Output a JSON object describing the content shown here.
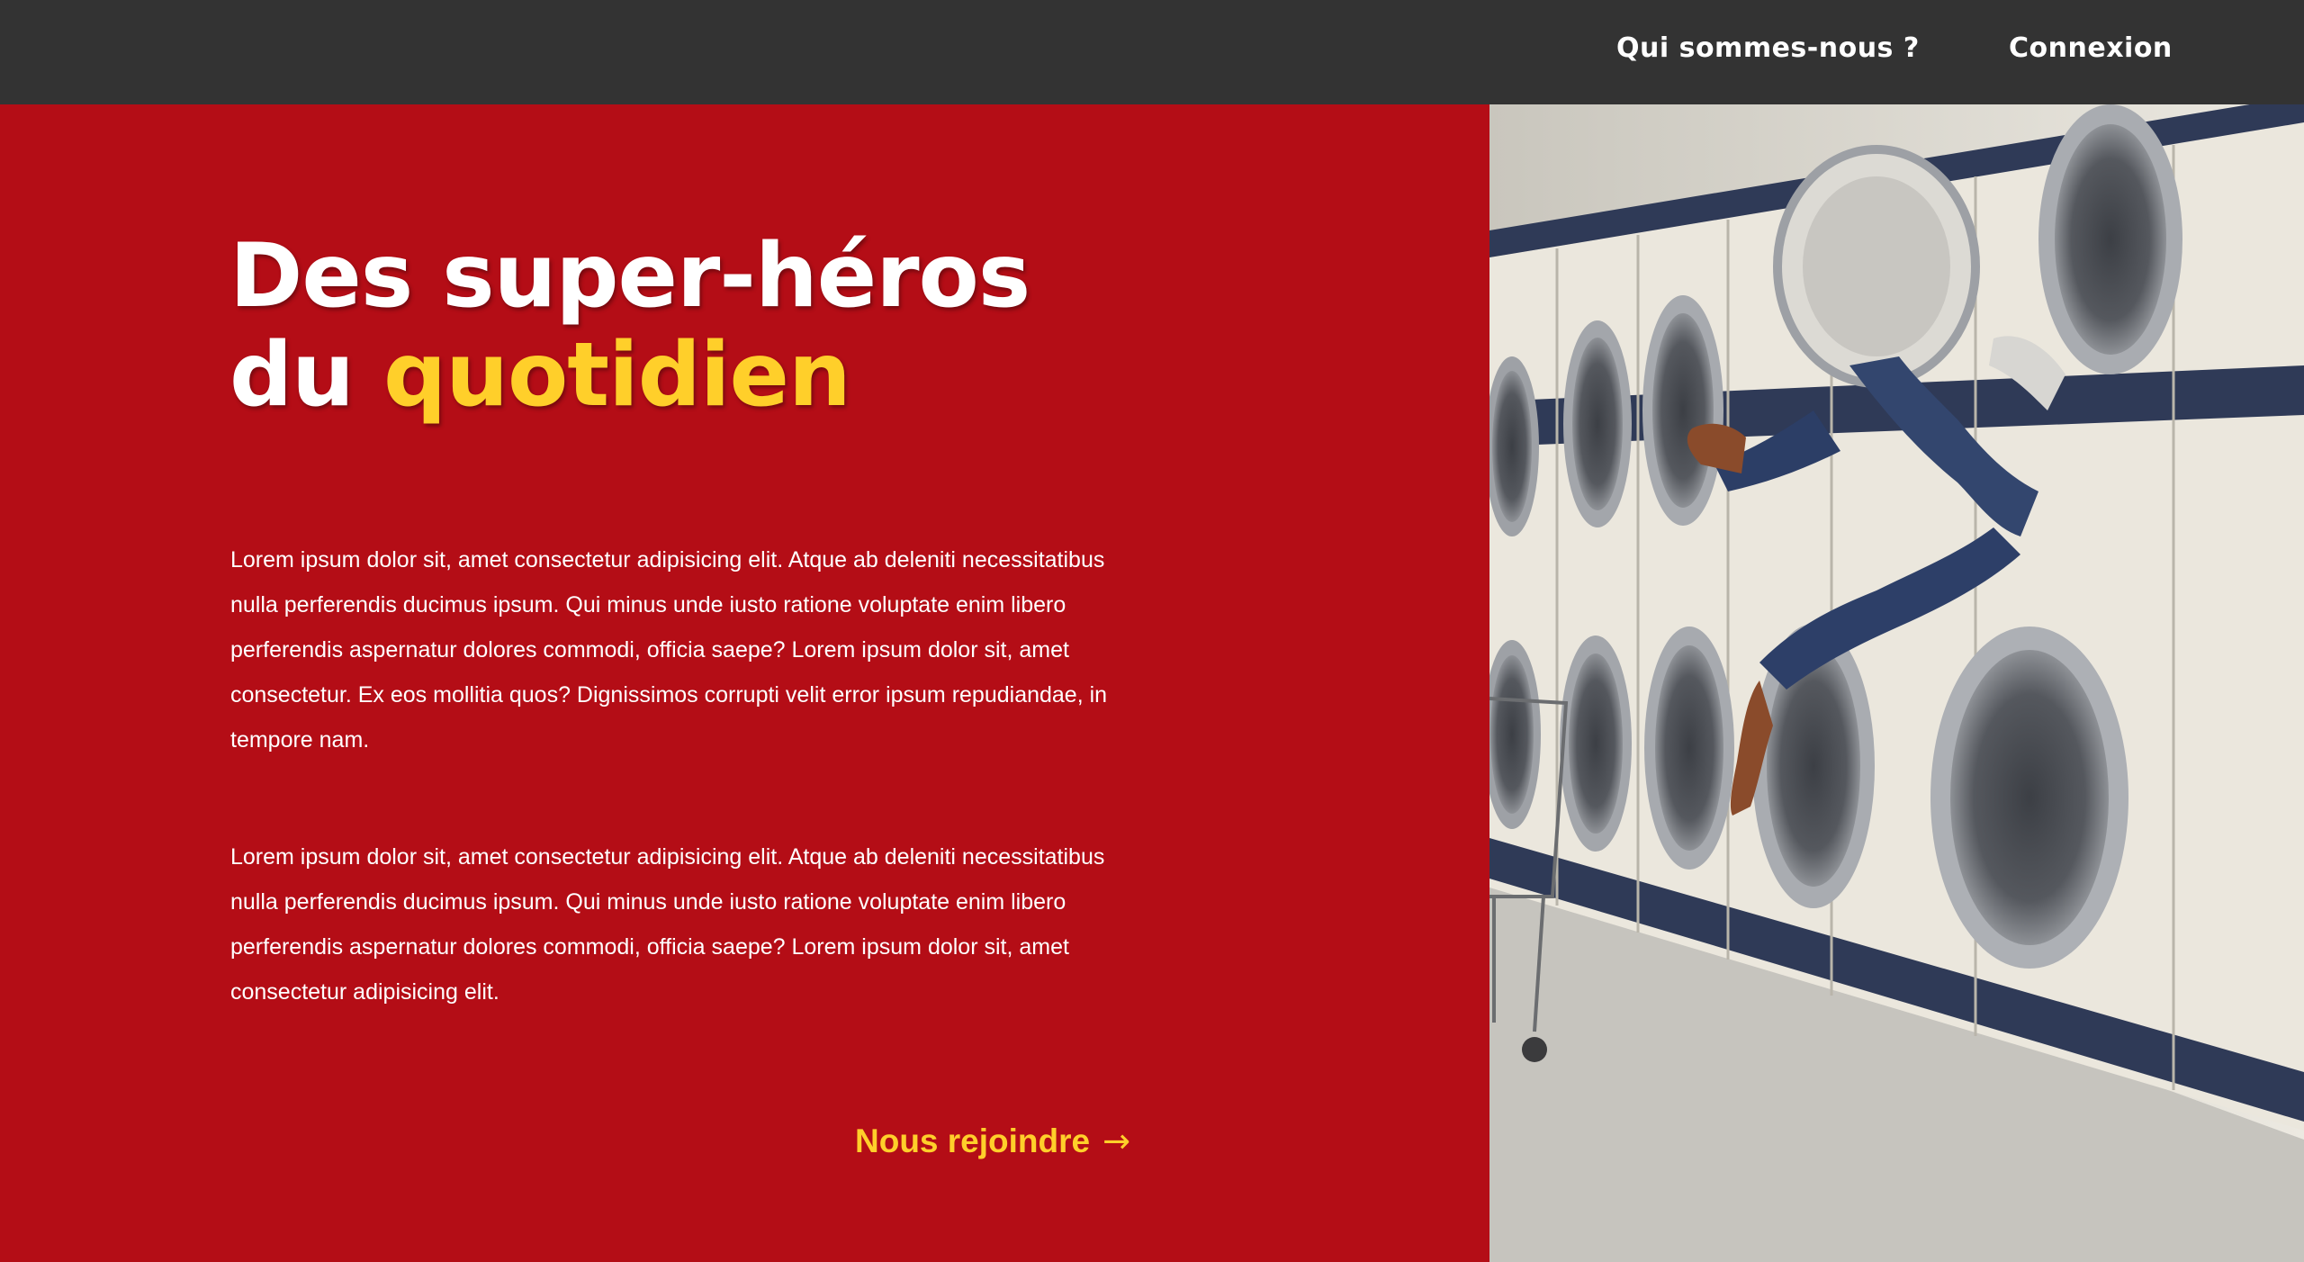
{
  "nav": {
    "about_label": "Qui sommes-nous ?",
    "login_label": "Connexion"
  },
  "hero": {
    "title_line1": "Des super-héros",
    "title_line2_prefix": "du ",
    "title_line2_accent": "quotidien",
    "paragraphs": [
      "Lorem ipsum dolor sit, amet consectetur adipisicing elit. Atque ab deleniti necessitatibus nulla perferendis ducimus ipsum. Qui minus unde iusto ratione voluptate enim libero perferendis aspernatur dolores commodi, officia saepe? Lorem ipsum dolor sit, amet consectetur. Ex eos mollitia quos? Dignissimos corrupti velit error ipsum repudiandae, in tempore nam.",
      "Lorem ipsum dolor sit, amet consectetur adipisicing elit. Atque ab deleniti necessitatibus nulla perferendis ducimus ipsum. Qui minus unde iusto ratione voluptate enim libero perferendis aspernatur dolores commodi, officia saepe? Lorem ipsum dolor sit, amet consectetur adipisicing elit."
    ],
    "cta_label": "Nous rejoindre",
    "cta_icon": "arrow-right-icon"
  },
  "colors": {
    "topbar": "#333333",
    "hero_background": "#b40d16",
    "accent": "#ffcf2a",
    "text": "#ffffff"
  }
}
